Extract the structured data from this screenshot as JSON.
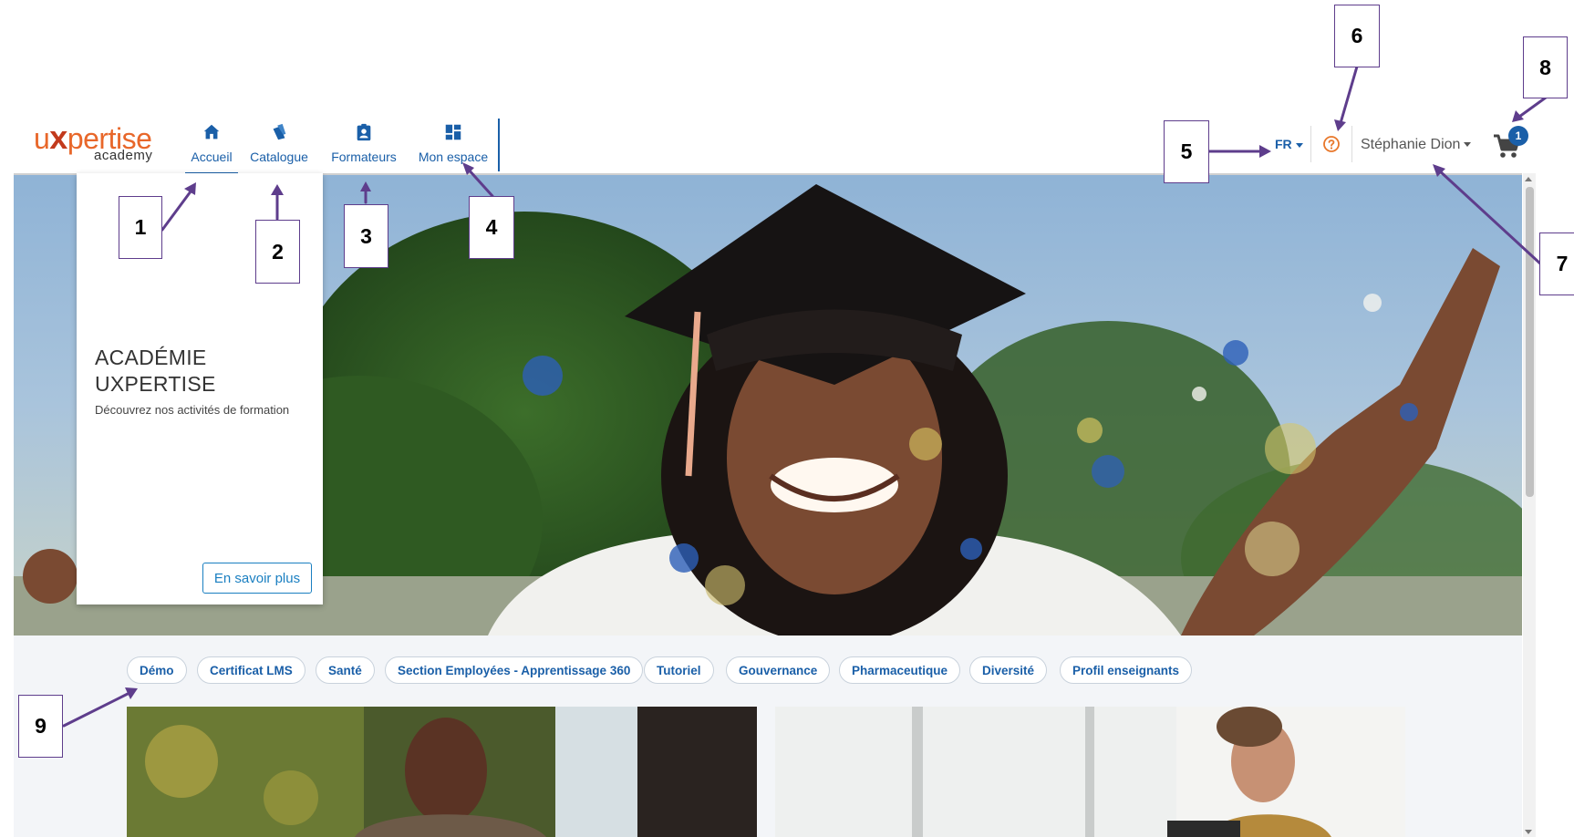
{
  "header": {
    "logo": {
      "brand_u": "u",
      "brand_x": "x",
      "brand_rest": "pertise",
      "subtitle": "academy"
    },
    "nav": [
      {
        "label": "Accueil",
        "icon": "home-icon",
        "active": true
      },
      {
        "label": "Catalogue",
        "icon": "books-icon",
        "active": false
      },
      {
        "label": "Formateurs",
        "icon": "badge-icon",
        "active": false
      },
      {
        "label": "Mon espace",
        "icon": "dashboard-icon",
        "active": false
      }
    ],
    "language": "FR",
    "user_name": "Stéphanie Dion",
    "cart_count": "1"
  },
  "hero": {
    "title": "ACADÉMIE UXPERTISE",
    "subtitle": "Découvrez nos activités de formation",
    "button_label": "En savoir plus"
  },
  "tags": [
    "Démo",
    "Certificat LMS",
    "Santé",
    "Section Employées - Apprentissage 360",
    "Tutoriel",
    "Gouvernance",
    "Pharmaceutique",
    "Diversité",
    "Profil enseignants"
  ],
  "callouts": [
    "1",
    "2",
    "3",
    "4",
    "5",
    "6",
    "7",
    "8",
    "9"
  ],
  "colors": {
    "accent": "#1a5fa8",
    "brand_orange": "#e8672a",
    "callout_border": "#5e3d8c",
    "help_icon": "#e8772a"
  }
}
